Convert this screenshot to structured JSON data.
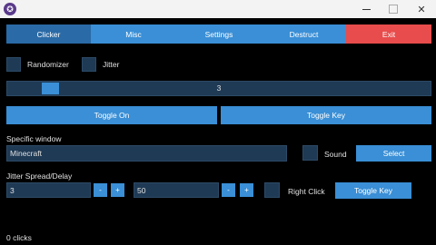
{
  "titlebar": {
    "app_icon_glyph": "✪",
    "min_icon": "minimize-icon",
    "max_icon": "maximize-icon",
    "close_glyph": "✕"
  },
  "tabs": [
    {
      "label": "Clicker",
      "active": true
    },
    {
      "label": "Misc"
    },
    {
      "label": "Settings"
    },
    {
      "label": "Destruct"
    },
    {
      "label": "Exit"
    }
  ],
  "options": {
    "randomizer_label": "Randomizer",
    "jitter_label": "Jitter"
  },
  "cps_slider": {
    "value": "3"
  },
  "buttons": {
    "toggle_on": "Toggle On",
    "toggle_key": "Toggle Key"
  },
  "window_section": {
    "heading": "Specific window",
    "window_value": "Minecraft",
    "sound_label": "Sound",
    "select_label": "Select"
  },
  "jitter_section": {
    "heading": "Jitter Spread/Delay",
    "spread_value": "3",
    "delay_value": "50",
    "minus": "-",
    "plus": "+",
    "right_click_label": "Right Click",
    "toggle_key_label": "Toggle Key"
  },
  "status": {
    "clicks": "0 clicks"
  },
  "colors": {
    "accent": "#3a8fd6",
    "active_tab": "#2a6aa6",
    "exit": "#e84c4c",
    "field": "#1f3a55",
    "background": "#000000"
  }
}
